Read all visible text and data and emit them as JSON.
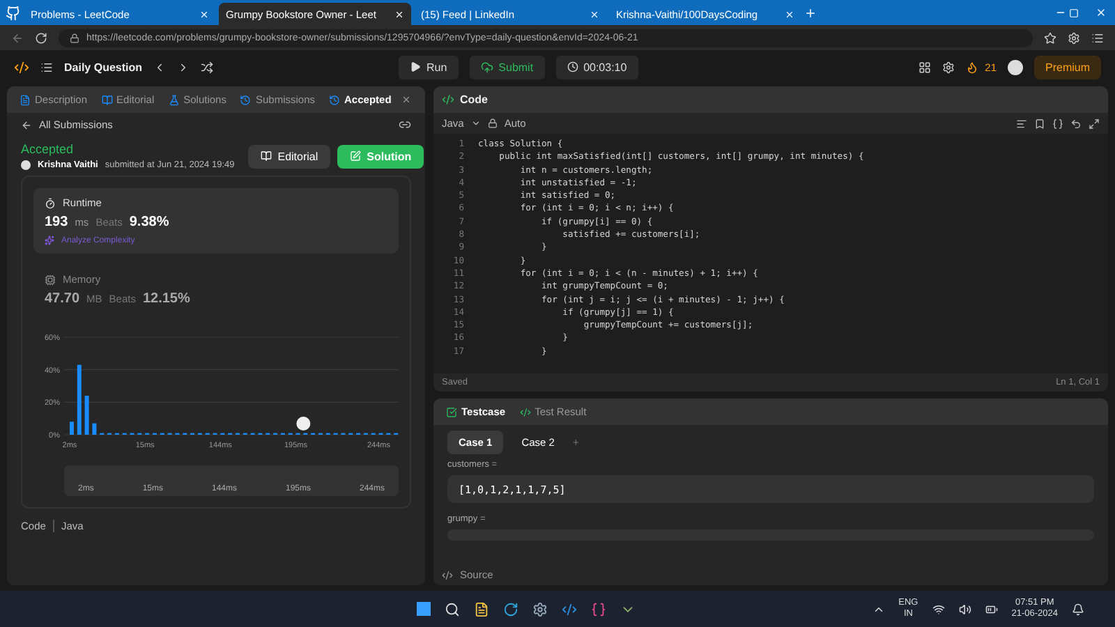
{
  "browser": {
    "tabs": [
      {
        "title": "Problems - LeetCode",
        "selected": false
      },
      {
        "title": "Grumpy Bookstore Owner - Leet",
        "selected": true
      },
      {
        "title": "(15) Feed | LinkedIn",
        "selected": false
      },
      {
        "title": "Krishna-Vaithi/100DaysCoding",
        "selected": false
      }
    ],
    "url": "https://leetcode.com/problems/grumpy-bookstore-owner/submissions/1295704966/?envType=daily-question&envId=2024-06-21"
  },
  "toolbar": {
    "title": "Daily Question",
    "run": "Run",
    "submit": "Submit",
    "timer": "00:03:10",
    "streak": "21",
    "premium": "Premium"
  },
  "left": {
    "tabs": [
      {
        "label": "Description",
        "selected": false
      },
      {
        "label": "Editorial",
        "selected": false
      },
      {
        "label": "Solutions",
        "selected": false
      },
      {
        "label": "Submissions",
        "selected": false
      },
      {
        "label": "Accepted",
        "selected": true
      }
    ],
    "back": "All Submissions",
    "status": "Accepted",
    "author": "Krishna Vaithi",
    "submitted": "submitted at Jun 21, 2024 19:49",
    "editorial_button": "Editorial",
    "solution_button": "Solution",
    "runtime": {
      "title": "Runtime",
      "value": "193",
      "unit": "ms",
      "beats_label": "Beats",
      "beats": "9.38%",
      "analyze": "Analyze Complexity"
    },
    "memory": {
      "title": "Memory",
      "value": "47.70",
      "unit": "MB",
      "beats_label": "Beats",
      "beats": "12.15%"
    },
    "chart_data": {
      "type": "bar",
      "values": [
        8,
        43,
        24,
        7,
        1,
        1,
        1,
        1,
        1,
        1,
        1,
        1,
        1,
        1,
        1,
        1,
        1,
        1,
        1,
        1,
        1,
        1,
        1,
        1,
        1,
        1,
        1,
        1,
        1,
        1,
        1,
        1,
        1,
        1,
        1,
        1,
        1,
        1,
        1,
        1,
        1,
        1,
        1,
        1
      ],
      "categories": [
        "2ms",
        null,
        null,
        null,
        null,
        null,
        null,
        null,
        null,
        null,
        "15ms",
        null,
        null,
        null,
        null,
        null,
        null,
        null,
        null,
        null,
        "144ms",
        null,
        null,
        null,
        null,
        null,
        null,
        null,
        null,
        null,
        "195ms",
        null,
        null,
        null,
        null,
        null,
        null,
        null,
        null,
        null,
        null,
        "244ms",
        null,
        null
      ],
      "ylim": [
        0,
        60
      ],
      "yticks": [
        {
          "value": 0,
          "label": "0%"
        },
        {
          "value": 20,
          "label": "20%"
        },
        {
          "value": 40,
          "label": "40%"
        },
        {
          "value": 60,
          "label": "60%"
        }
      ]
    },
    "range_labels": [
      "2ms",
      "15ms",
      "144ms",
      "195ms",
      "244ms"
    ],
    "code_label": "Code",
    "code_lang": "Java"
  },
  "editor": {
    "title": "Code",
    "language": "Java",
    "mode": "Auto",
    "lines": [
      {
        "number": "1",
        "text": "class Solution {"
      },
      {
        "number": "2",
        "text": "    public int maxSatisfied(int[] customers, int[] grumpy, int minutes) {"
      },
      {
        "number": "3",
        "text": "        int n = customers.length;"
      },
      {
        "number": "4",
        "text": "        int unstatisfied = -1;"
      },
      {
        "number": "5",
        "text": "        int satisfied = 0;"
      },
      {
        "number": "6",
        "text": "        for (int i = 0; i < n; i++) {"
      },
      {
        "number": "7",
        "text": "            if (grumpy[i] == 0) {"
      },
      {
        "number": "8",
        "text": "                satisfied += customers[i];"
      },
      {
        "number": "9",
        "text": "            }"
      },
      {
        "number": "10",
        "text": "        }"
      },
      {
        "number": "11",
        "text": "        for (int i = 0; i < (n - minutes) + 1; i++) {"
      },
      {
        "number": "12",
        "text": "            int grumpyTempCount = 0;"
      },
      {
        "number": "13",
        "text": "            for (int j = i; j <= (i + minutes) - 1; j++) {"
      },
      {
        "number": "14",
        "text": "                if (grumpy[j] == 1) {"
      },
      {
        "number": "15",
        "text": "                    grumpyTempCount += customers[j];"
      },
      {
        "number": "16",
        "text": "                }"
      },
      {
        "number": "17",
        "text": "            }"
      }
    ],
    "saved": "Saved",
    "position": "Ln 1, Col 1"
  },
  "testpanel": {
    "tabs": [
      {
        "label": "Testcase",
        "selected": true
      },
      {
        "label": "Test Result",
        "selected": false
      }
    ],
    "cases": [
      {
        "label": "Case 1",
        "selected": true
      },
      {
        "label": "Case 2",
        "selected": false
      }
    ],
    "add": "+",
    "params": [
      {
        "name": "customers =",
        "value": "[1,0,1,2,1,1,7,5]"
      },
      {
        "name": "grumpy ="
      }
    ],
    "source": "Source"
  },
  "taskbar": {
    "lang": "ENG",
    "region": "IN",
    "time": "07:51 PM",
    "date": "21-06-2024"
  }
}
